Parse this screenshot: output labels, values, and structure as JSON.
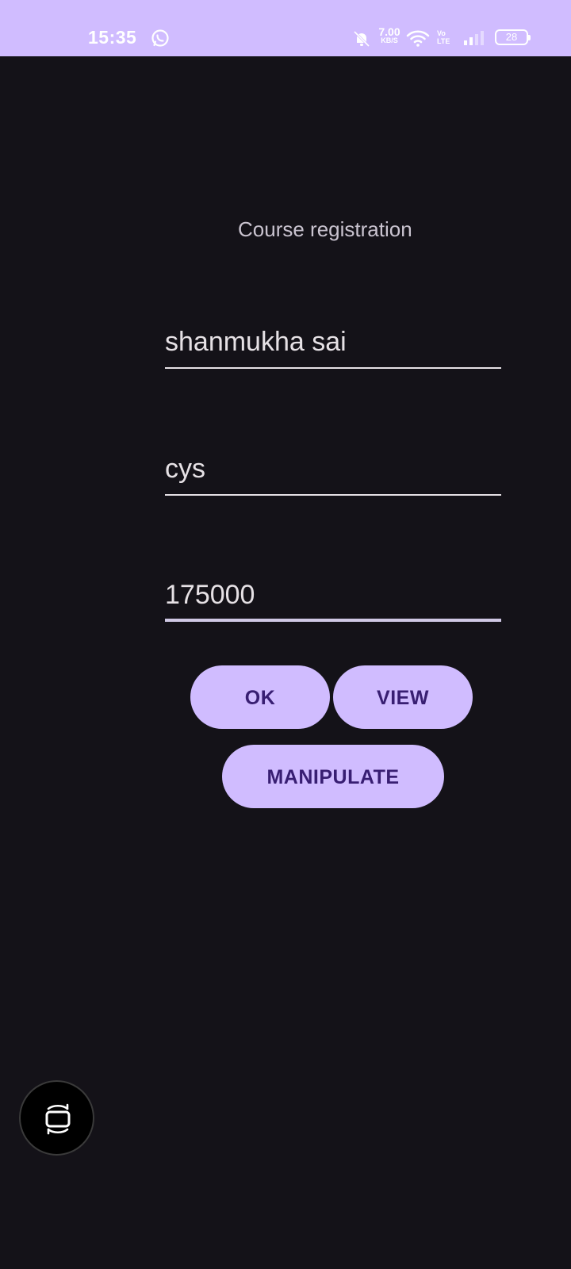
{
  "status_bar": {
    "time": "15:35",
    "net_speed_value": "7.00",
    "net_speed_unit": "KB/S",
    "volte_top": "Vo",
    "volte_bottom": "LTE",
    "battery": "28",
    "icons": [
      "whatsapp-icon",
      "mute-icon",
      "wifi-icon",
      "signal-icon",
      "battery-icon"
    ]
  },
  "page": {
    "title": "Course registration"
  },
  "form": {
    "name_value": "shanmukha sai",
    "course_value": "cys",
    "fee_value": "175000"
  },
  "buttons": {
    "ok_label": "OK",
    "view_label": "VIEW",
    "manipulate_label": "MANIPULATE"
  },
  "floating": {
    "icon": "screen-rotate-icon"
  },
  "colors": {
    "accent": "#d0bcff",
    "accent_text": "#381e72",
    "background": "#141218",
    "text": "#e6e1e5"
  }
}
